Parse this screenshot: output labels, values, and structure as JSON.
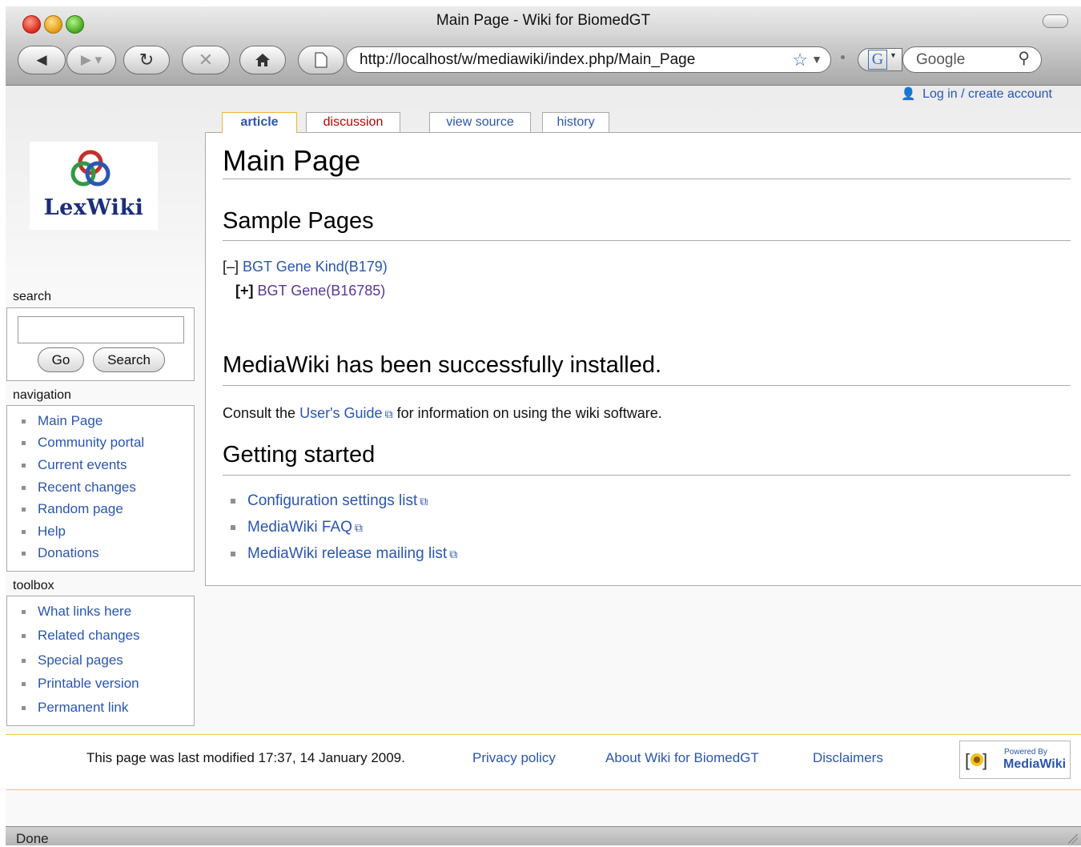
{
  "window": {
    "title": "Main Page - Wiki for BiomedGT"
  },
  "browser": {
    "url": "http://localhost/w/mediawiki/index.php/Main_Page",
    "search_engine": "Google"
  },
  "personal": {
    "login": "Log in / create account"
  },
  "tabs": [
    {
      "label": "article"
    },
    {
      "label": "discussion"
    },
    {
      "label": "view source"
    },
    {
      "label": "history"
    }
  ],
  "logo": {
    "text": "LexWiki"
  },
  "sidebar": {
    "search_heading": "search",
    "go_label": "Go",
    "search_label": "Search",
    "navigation_heading": "navigation",
    "navigation": [
      {
        "label": "Main Page"
      },
      {
        "label": "Community portal"
      },
      {
        "label": "Current events"
      },
      {
        "label": "Recent changes"
      },
      {
        "label": "Random page"
      },
      {
        "label": "Help"
      },
      {
        "label": "Donations"
      }
    ],
    "toolbox_heading": "toolbox",
    "toolbox": [
      {
        "label": "What links here"
      },
      {
        "label": "Related changes"
      },
      {
        "label": "Special pages"
      },
      {
        "label": "Printable version"
      },
      {
        "label": "Permanent link"
      }
    ]
  },
  "content": {
    "title": "Main Page",
    "sample_heading": "Sample Pages",
    "tree": [
      {
        "toggle": "[–]",
        "label": "BGT Gene Kind(B179)"
      },
      {
        "toggle": "[+]",
        "label": "BGT Gene(B16785)"
      }
    ],
    "install_heading": "MediaWiki has been successfully installed.",
    "consult_prefix": "Consult the",
    "consult_link": "User's Guide",
    "consult_suffix": "for information on using the wiki software.",
    "started_heading": "Getting started",
    "started_links": [
      {
        "label": "Configuration settings list"
      },
      {
        "label": "MediaWiki FAQ"
      },
      {
        "label": "MediaWiki release mailing list"
      }
    ]
  },
  "footer": {
    "modified": "This page was last modified 17:37, 14 January 2009.",
    "privacy": "Privacy policy",
    "about": "About Wiki for BiomedGT",
    "disclaimers": "Disclaimers",
    "powered_small": "Powered By",
    "powered_big": "MediaWiki"
  },
  "status": {
    "text": "Done"
  }
}
